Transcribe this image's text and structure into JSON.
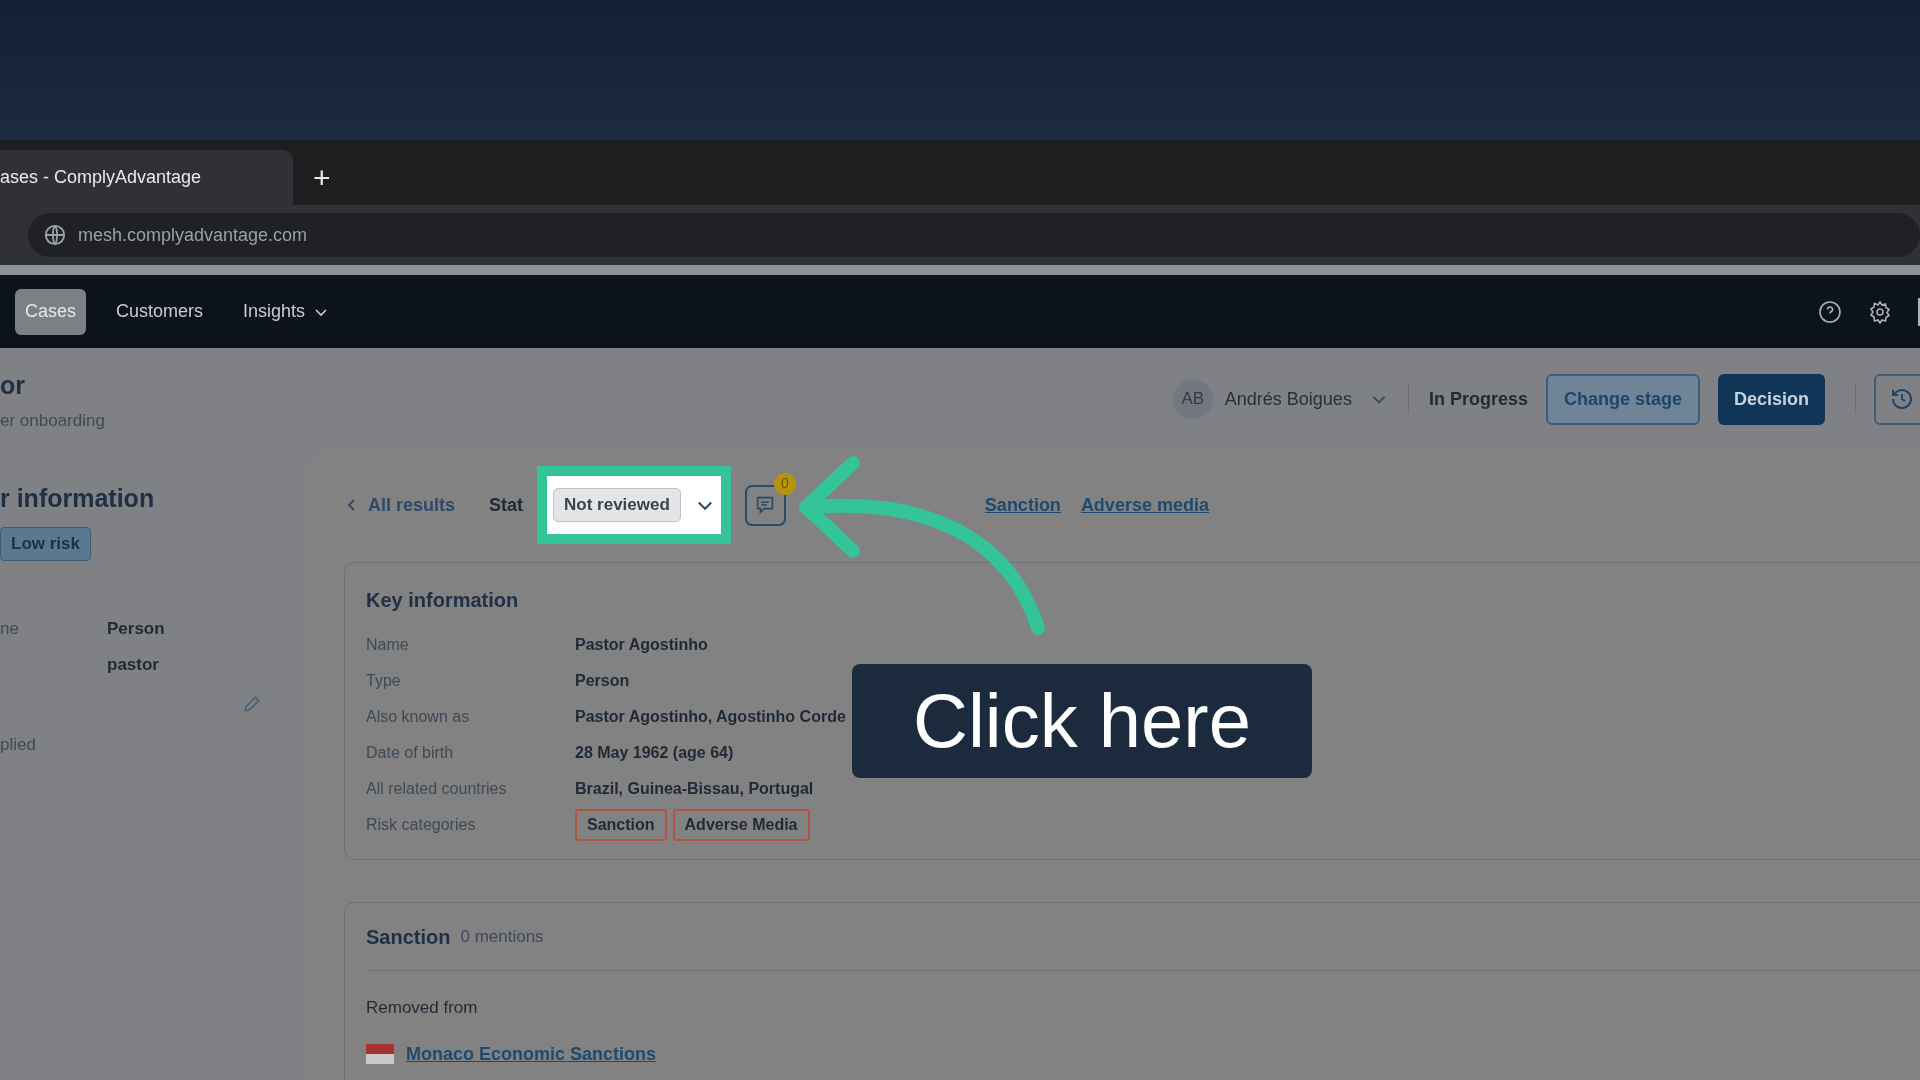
{
  "browser": {
    "tab_title": "ases - ComplyAdvantage",
    "new_tab": "+",
    "url": "mesh.complyadvantage.com"
  },
  "nav": {
    "items": [
      {
        "label": "Cases",
        "selected": true,
        "dropdown": false
      },
      {
        "label": "Customers",
        "selected": false,
        "dropdown": false
      },
      {
        "label": "Insights",
        "selected": false,
        "dropdown": true
      }
    ]
  },
  "header": {
    "title": "or",
    "subtitle": "er onboarding",
    "assignee": {
      "initials": "AB",
      "name": "Andrés Boigues"
    },
    "stage": "In Progress",
    "buttons": [
      {
        "label": "Change stage",
        "kind": "secondary"
      },
      {
        "label": "Decision",
        "kind": "primary"
      }
    ]
  },
  "sidebar": {
    "title": "r information",
    "badge": "Low risk",
    "rows": [
      {
        "label": "ne",
        "value": "Person"
      },
      {
        "value": "pastor"
      }
    ],
    "edit_row": true,
    "footer": "plied"
  },
  "result": {
    "back": "All results",
    "status_label": "Stat",
    "status": "Not reviewed",
    "comments": "0",
    "links": [
      "Sanction",
      "Adverse media"
    ]
  },
  "key_information": {
    "title": "Key information",
    "rows": [
      {
        "label": "Name",
        "kind": "text",
        "value": "Pastor Agostinho"
      },
      {
        "label": "Type",
        "kind": "text",
        "value": "Person"
      },
      {
        "label": "Also known as",
        "kind": "text",
        "value": "Pastor Agostinho, Agostinho Corde"
      },
      {
        "label": "Date of birth",
        "kind": "text",
        "value": "28 May 1962 (age 64)"
      },
      {
        "label": "All related countries",
        "kind": "text",
        "value": "Brazil, Guinea-Bissau, Portugal"
      },
      {
        "label": "Risk categories",
        "kind": "tags",
        "tags": [
          "Sanction",
          "Adverse Media"
        ]
      }
    ]
  },
  "sanction": {
    "title": "Sanction",
    "mentions": "0 mentions",
    "removed_label": "Removed from",
    "lists": [
      "Monaco Economic Sanctions"
    ]
  },
  "callout": {
    "text": "Click here"
  }
}
